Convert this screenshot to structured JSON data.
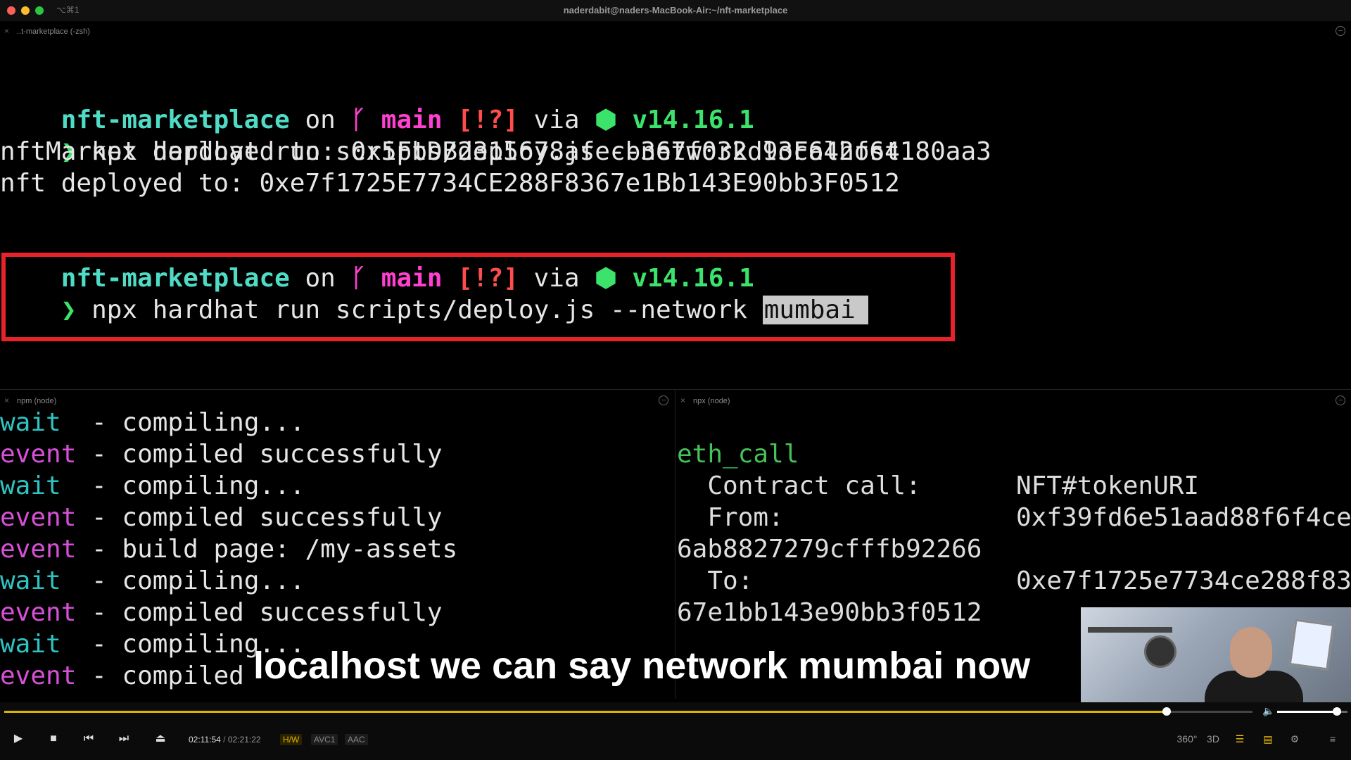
{
  "window": {
    "title": "naderdabit@naders-MacBook-Air:~/nft-marketplace",
    "shortcut": "⌥⌘1"
  },
  "top_pane": {
    "tab_label": "..t-marketplace (-zsh)",
    "prompt1": {
      "dir": "nft-marketplace",
      "on": " on ",
      "branch_icon": "ᚴ",
      "branch": " main ",
      "status": "[!?]",
      "via": " via ",
      "node_icon": "⬢",
      "node_version": " v14.16.1"
    },
    "cmd1": {
      "arrow": "❯",
      "text": " npx hardhat run scripts/deploy.js --network localhost"
    },
    "out1": "nftMarket deployed to: 0x5FbDB2315678afecb367f032d93F642f64180aa3",
    "out2": "nft deployed to: 0xe7f1725E7734CE288F8367e1Bb143E90bb3F0512",
    "prompt2": {
      "dir": "nft-marketplace",
      "on": " on ",
      "branch_icon": "ᚴ",
      "branch": " main ",
      "status": "[!?]",
      "via": " via ",
      "node_icon": "⬢",
      "node_version": " v14.16.1"
    },
    "cmd2": {
      "arrow": "❯",
      "text": " npx hardhat run scripts/deploy.js --network ",
      "selected": "mumbai"
    }
  },
  "left_pane": {
    "tab_label": "npm (node)",
    "lines": [
      {
        "tag": "wait",
        "rest": "  - compiling..."
      },
      {
        "tag": "event",
        "rest": " - compiled successfully"
      },
      {
        "tag": "wait",
        "rest": "  - compiling..."
      },
      {
        "tag": "event",
        "rest": " - compiled successfully"
      },
      {
        "tag": "event",
        "rest": " - build page: /my-assets"
      },
      {
        "tag": "wait",
        "rest": "  - compiling..."
      },
      {
        "tag": "event",
        "rest": " - compiled successfully"
      },
      {
        "tag": "wait",
        "rest": "  - compiling..."
      },
      {
        "tag": "event",
        "rest": " - compiled "
      }
    ]
  },
  "right_pane": {
    "tab_label": "npx (node)",
    "method": "eth_call",
    "contract_label": "  Contract call:",
    "contract_value": "NFT#tokenURI",
    "from_label": "  From:",
    "from_value": "0xf39fd6e51aad88f6f4ce",
    "from_cont": "6ab8827279cfffb92266",
    "to_label": "  To:",
    "to_value": "0xe7f1725e7734ce288f83",
    "to_cont": "67e1bb143e90bb3f0512"
  },
  "caption": "localhost we can say network mumbai now",
  "player": {
    "progress": 0.9315,
    "volume": 0.85,
    "current_time": "02:11:54",
    "separator": "/",
    "total_time": "02:21:22",
    "badges": [
      "H/W",
      "AVC1",
      "AAC"
    ],
    "right_icons": {
      "vr": "360°",
      "three_d": "3D"
    }
  }
}
